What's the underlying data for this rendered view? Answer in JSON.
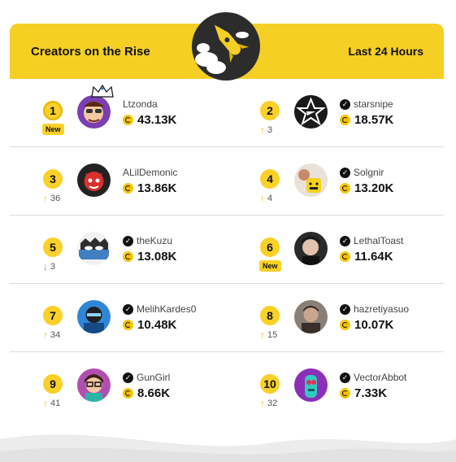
{
  "header": {
    "title": "Creators on the Rise",
    "range_label": "Last 24 Hours"
  },
  "colors": {
    "accent": "#f5cf24",
    "text": "#111111",
    "muted": "#555555",
    "divider": "#dcdcdc"
  },
  "rows": [
    [
      {
        "rank": "1",
        "movement": "New",
        "movement_type": "new",
        "name": "Ltzonda",
        "verified": false,
        "coins": "43.13K",
        "avatar": "cartoon-avatar-with-crown"
      },
      {
        "rank": "2",
        "movement": "3",
        "movement_type": "up",
        "name": "starsnipe",
        "verified": true,
        "coins": "18.57K",
        "avatar": "star-logo-avatar"
      }
    ],
    [
      {
        "rank": "3",
        "movement": "36",
        "movement_type": "up",
        "name": "ALilDemonic",
        "verified": false,
        "coins": "13.86K",
        "avatar": "red-demon-avatar"
      },
      {
        "rank": "4",
        "movement": "4",
        "movement_type": "up",
        "name": "Solgnir",
        "verified": true,
        "coins": "13.20K",
        "avatar": "yellow-lego-avatar"
      }
    ],
    [
      {
        "rank": "5",
        "movement": "3",
        "movement_type": "down",
        "name": "theKuzu",
        "verified": true,
        "coins": "13.08K",
        "avatar": "masked-character-avatar"
      },
      {
        "rank": "6",
        "movement": "New",
        "movement_type": "new",
        "name": "LethalToast",
        "verified": true,
        "coins": "11.64K",
        "avatar": "person-photo-avatar"
      }
    ],
    [
      {
        "rank": "7",
        "movement": "34",
        "movement_type": "up",
        "name": "MelihKardes0",
        "verified": true,
        "coins": "10.48K",
        "avatar": "blue-character-avatar"
      },
      {
        "rank": "8",
        "movement": "15",
        "movement_type": "up",
        "name": "hazretiyasuo",
        "verified": true,
        "coins": "10.07K",
        "avatar": "dark-portrait-avatar"
      }
    ],
    [
      {
        "rank": "9",
        "movement": "41",
        "movement_type": "up",
        "name": "GunGirl",
        "verified": true,
        "coins": "8.66K",
        "avatar": "glasses-girl-avatar"
      },
      {
        "rank": "10",
        "movement": "32",
        "movement_type": "up",
        "name": "VectorAbbot",
        "verified": true,
        "coins": "7.33K",
        "avatar": "purple-character-avatar"
      }
    ]
  ]
}
